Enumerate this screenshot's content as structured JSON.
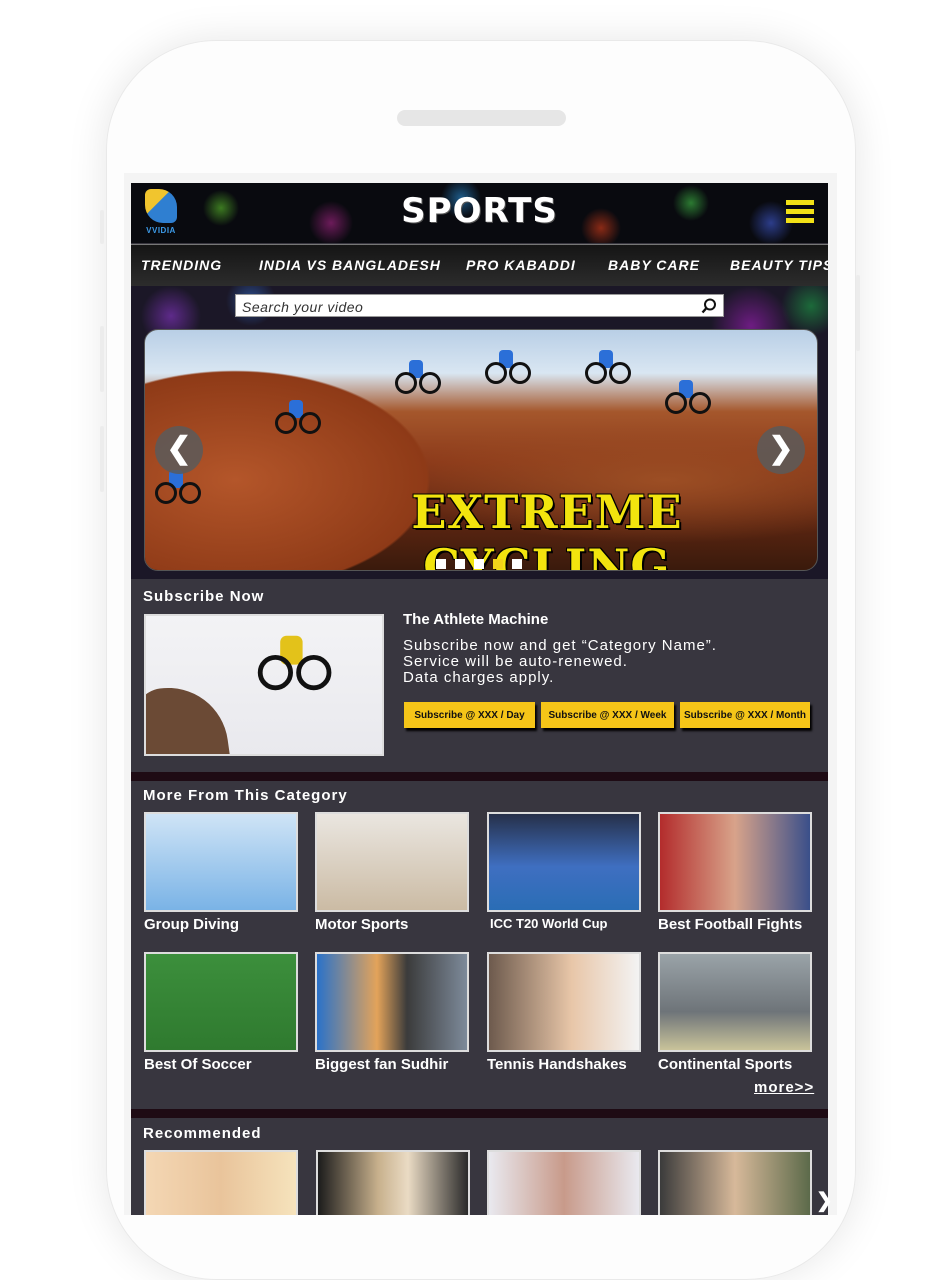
{
  "header": {
    "logo_text": "VVIDIA",
    "title": "SPORTS"
  },
  "nav": {
    "items": [
      "TRENDING",
      "INDIA VS BANGLADESH",
      "PRO KABADDI",
      "BABY CARE",
      "BEAUTY TIPS"
    ]
  },
  "search": {
    "placeholder": "Search your video"
  },
  "banner": {
    "title": "EXTREME CYCLING",
    "prev_glyph": "❮",
    "next_glyph": "❯",
    "slide_count": 5,
    "active_index": 3
  },
  "subscribe": {
    "heading": "Subscribe Now",
    "title": "The Athlete Machine",
    "description_line1": "Subscribe now and get “Category Name”.",
    "description_line2": "Service will be auto-renewed.",
    "description_line3": "Data charges apply.",
    "buttons": [
      "Subscribe @ XXX / Day",
      "Subscribe @ XXX / Week",
      "Subscribe @ XXX / Month"
    ]
  },
  "more_category": {
    "heading": "More From This Category",
    "items": [
      {
        "caption": "Group Diving"
      },
      {
        "caption": "Motor Sports"
      },
      {
        "caption": "ICC T20 World Cup"
      },
      {
        "caption": "Best Football Fights"
      },
      {
        "caption": "Best Of Soccer"
      },
      {
        "caption": "Biggest fan Sudhir"
      },
      {
        "caption": "Tennis Handshakes"
      },
      {
        "caption": "Continental  Sports"
      }
    ],
    "more_link": "more>>"
  },
  "recommended": {
    "heading": "Recommended",
    "next_glyph": "❯"
  },
  "colors": {
    "accent": "#f2e116",
    "button": "#f5c518",
    "panel": "#38363f",
    "divider": "#1e0b14"
  }
}
